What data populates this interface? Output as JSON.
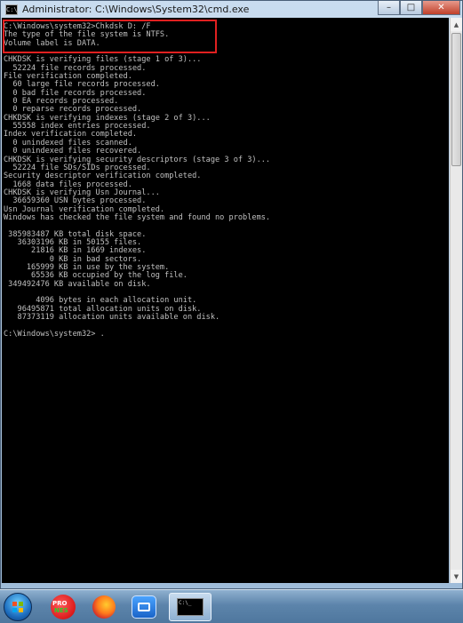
{
  "window": {
    "title": "Administrator: C:\\Windows\\System32\\cmd.exe",
    "icon": "cmd-icon",
    "icon_text": "C:\\",
    "controls": {
      "minimize": "–",
      "maximize": "□",
      "close": "✕"
    }
  },
  "console": {
    "lines": [
      "C:\\Windows\\system32>Chkdsk D: /F",
      "The type of the file system is NTFS.",
      "Volume label is DATA.",
      "",
      "CHKDSK is verifying files (stage 1 of 3)...",
      "  52224 file records processed.",
      "File verification completed.",
      "  60 large file records processed.",
      "  0 bad file records processed.",
      "  0 EA records processed.",
      "  0 reparse records processed.",
      "CHKDSK is verifying indexes (stage 2 of 3)...",
      "  55558 index entries processed.",
      "Index verification completed.",
      "  0 unindexed files scanned.",
      "  0 unindexed files recovered.",
      "CHKDSK is verifying security descriptors (stage 3 of 3)...",
      "  52224 file SDs/SIDs processed.",
      "Security descriptor verification completed.",
      "  1668 data files processed.",
      "CHKDSK is verifying Usn Journal...",
      "  36659360 USN bytes processed.",
      "Usn Journal verification completed.",
      "Windows has checked the file system and found no problems.",
      "",
      " 385983487 KB total disk space.",
      "   36303196 KB in 50155 files.",
      "      21816 KB in 1669 indexes.",
      "          0 KB in bad sectors.",
      "     165999 KB in use by the system.",
      "      65536 KB occupied by the log file.",
      " 349492476 KB available on disk.",
      "",
      "       4096 bytes in each allocation unit.",
      "   96495871 total allocation units on disk.",
      "   87373119 allocation units available on disk.",
      "",
      "C:\\Windows\\system32> ."
    ]
  },
  "highlight": {
    "color": "#e02020"
  },
  "taskbar": {
    "start_icon": "windows-start-orb",
    "pinned": [
      {
        "name": "pronexus-icon",
        "line1": "PRO",
        "line2": "NES"
      },
      {
        "name": "firefox-icon"
      },
      {
        "name": "teamviewer-icon"
      },
      {
        "name": "cmd-taskbar-button",
        "thumb_text": "C:\\_"
      }
    ]
  },
  "colors": {
    "console_bg": "#000000",
    "console_fg": "#c0c0c0",
    "highlight": "#e02020"
  }
}
